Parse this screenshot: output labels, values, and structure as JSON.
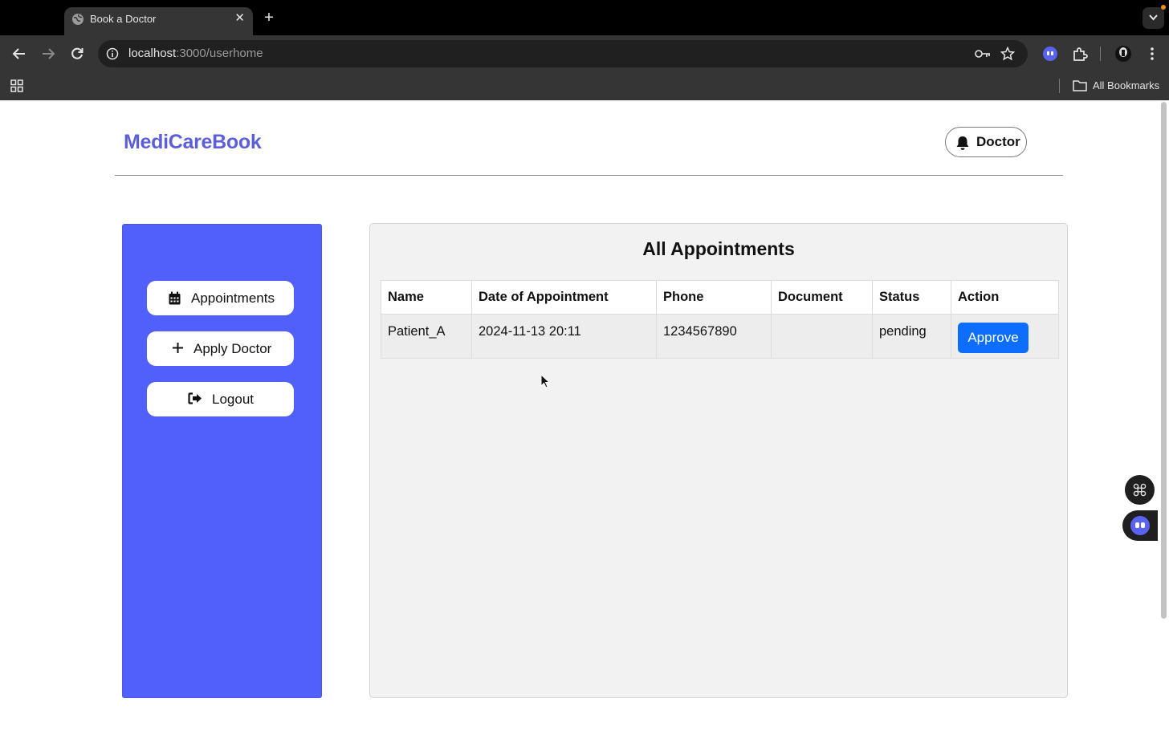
{
  "browser": {
    "tab_title": "Book a Doctor",
    "tab_close": "✕",
    "new_tab": "+",
    "url_host": "localhost",
    "url_rest": ":3000/userhome",
    "bookmarks_label": "All Bookmarks"
  },
  "header": {
    "brand": "MediCareBook",
    "notification_label": "Doctor"
  },
  "sidebar": {
    "items": [
      {
        "label": "Appointments",
        "icon": "calendar-icon"
      },
      {
        "label": "Apply Doctor",
        "icon": "plus-icon"
      },
      {
        "label": "Logout",
        "icon": "logout-icon"
      }
    ]
  },
  "main": {
    "title": "All Appointments",
    "table": {
      "columns": [
        "Name",
        "Date of Appointment",
        "Phone",
        "Document",
        "Status",
        "Action"
      ],
      "rows": [
        {
          "name": "Patient_A",
          "date": "2024-11-13 20:11",
          "phone": "1234567890",
          "document": "",
          "status": "pending",
          "action": "Approve"
        }
      ]
    }
  },
  "colors": {
    "brand": "#5b5fd9",
    "sidebar_bg": "#5160fb",
    "approve_button": "#0d6efd",
    "card_bg": "#f2f2f2"
  }
}
